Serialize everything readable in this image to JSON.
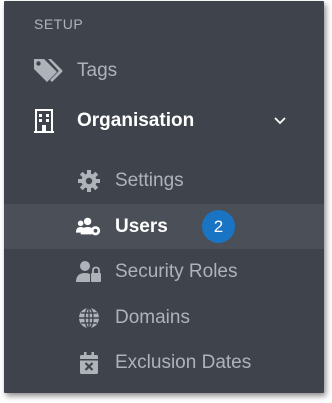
{
  "sidebar": {
    "section_header": "SETUP",
    "items": [
      {
        "label": "Tags",
        "icon": "tags-icon"
      },
      {
        "label": "Organisation",
        "icon": "building-icon",
        "expanded": true
      }
    ],
    "subitems": [
      {
        "label": "Settings",
        "icon": "gear-icon"
      },
      {
        "label": "Users",
        "icon": "users-gear-icon",
        "badge": "2",
        "active": true
      },
      {
        "label": "Security Roles",
        "icon": "user-lock-icon"
      },
      {
        "label": "Domains",
        "icon": "globe-icon"
      },
      {
        "label": "Exclusion Dates",
        "icon": "calendar-x-icon"
      }
    ]
  },
  "colors": {
    "panel_bg": "#3f444c",
    "active_row_bg": "#4b5058",
    "muted_text": "#aeb3ba",
    "active_text": "#ffffff",
    "badge_bg": "#1a74c4"
  }
}
